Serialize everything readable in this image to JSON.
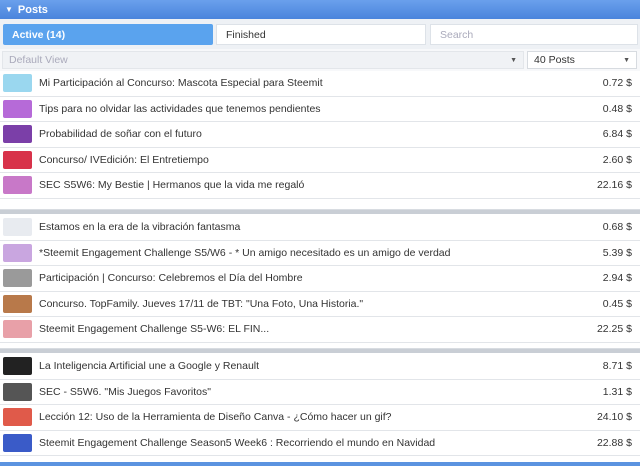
{
  "header": {
    "title": "Posts"
  },
  "tabs": {
    "active": "Active (14)",
    "finished": "Finished",
    "search_placeholder": "Search"
  },
  "filters": {
    "view": "Default View",
    "count": "40 Posts"
  },
  "groups": [
    [
      {
        "title": "Mi Participación al Concurso: Mascota Especial para Steemit",
        "amount": "0.72 $",
        "thumb": "#9ad7ef"
      },
      {
        "title": "Tips para no olvidar las actividades que tenemos pendientes",
        "amount": "0.48 $",
        "thumb": "#b66ad8"
      },
      {
        "title": "Probabilidad de soñar con el futuro",
        "amount": "6.84 $",
        "thumb": "#7b3fa8"
      },
      {
        "title": "Concurso/ IVEdición: El Entretiempo",
        "amount": "2.60 $",
        "thumb": "#d8324a"
      },
      {
        "title": "SEC S5W6: My Bestie | Hermanos que la vida me regaló",
        "amount": "22.16 $",
        "thumb": "#c878c8"
      }
    ],
    [
      {
        "title": "Estamos en la era de la vibración fantasma",
        "amount": "0.68 $",
        "thumb": "#e8ebf0"
      },
      {
        "title": "*Steemit Engagement Challenge S5/W6 - * Un amigo necesitado es un amigo de verdad",
        "amount": "5.39 $",
        "thumb": "#c9a6e0"
      },
      {
        "title": "Participación | Concurso: Celebremos el Día del Hombre",
        "amount": "2.94 $",
        "thumb": "#9a9a9a"
      },
      {
        "title": "Concurso. TopFamily. Jueves 17/11 de TBT: \"Una Foto, Una Historia.\"",
        "amount": "0.45 $",
        "thumb": "#b8794a"
      },
      {
        "title": "Steemit Engagement Challenge S5-W6: EL FIN...",
        "amount": "22.25 $",
        "thumb": "#e8a0a8"
      }
    ],
    [
      {
        "title": "La Inteligencia Artificial une a Google y Renault",
        "amount": "8.71 $",
        "thumb": "#222222"
      },
      {
        "title": "SEC - S5W6. \"Mis Juegos Favoritos\"",
        "amount": "1.31 $",
        "thumb": "#555555"
      },
      {
        "title": "Lección 12: Uso de la Herramienta de Diseño Canva - ¿Cómo hacer un gif?",
        "amount": "24.10 $",
        "thumb": "#e05a4a"
      },
      {
        "title": "Steemit Engagement Challenge Season5 Week6 : Recorriendo el mundo en Navidad",
        "amount": "22.88 $",
        "thumb": "#3a5bc8"
      }
    ]
  ]
}
